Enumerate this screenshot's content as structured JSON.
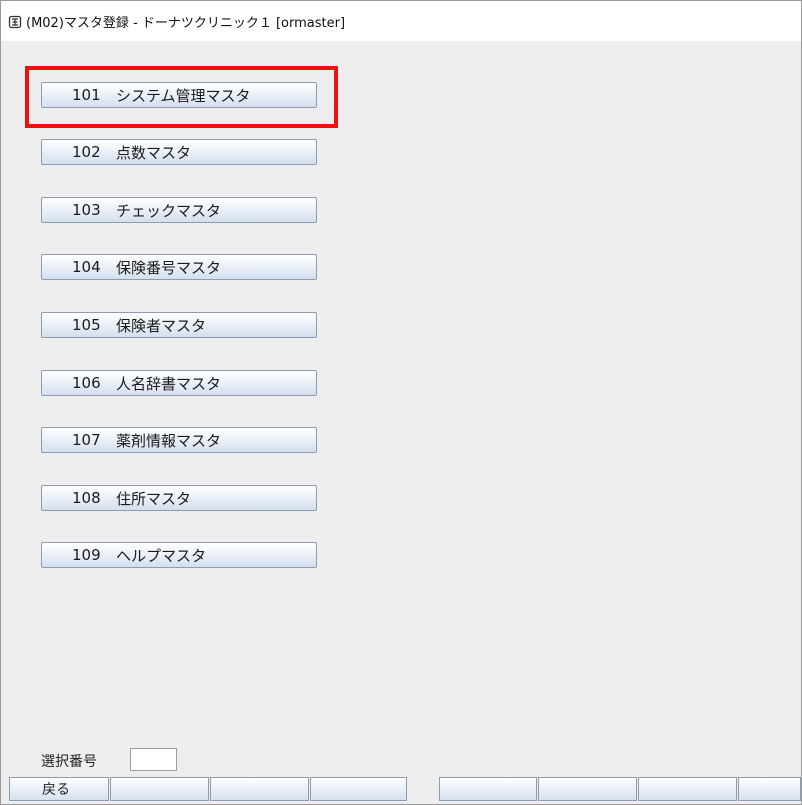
{
  "window": {
    "title": "(M02)マスタ登録 - ドーナツクリニック１ [ormaster]"
  },
  "menu": {
    "items": [
      {
        "number": "101",
        "label": "システム管理マスタ"
      },
      {
        "number": "102",
        "label": "点数マスタ"
      },
      {
        "number": "103",
        "label": "チェックマスタ"
      },
      {
        "number": "104",
        "label": "保険番号マスタ"
      },
      {
        "number": "105",
        "label": "保険者マスタ"
      },
      {
        "number": "106",
        "label": "人名辞書マスタ"
      },
      {
        "number": "107",
        "label": "薬剤情報マスタ"
      },
      {
        "number": "108",
        "label": "住所マスタ"
      },
      {
        "number": "109",
        "label": "ヘルプマスタ"
      }
    ]
  },
  "selection": {
    "label": "選択番号",
    "value": ""
  },
  "function_keys": [
    {
      "label": "戻る"
    },
    {
      "label": ""
    },
    {
      "label": ""
    },
    {
      "label": ""
    },
    {
      "label": ""
    },
    {
      "label": ""
    },
    {
      "label": ""
    },
    {
      "label": ""
    }
  ],
  "colors": {
    "highlight": "#ee1111",
    "background": "#eeeeee"
  }
}
